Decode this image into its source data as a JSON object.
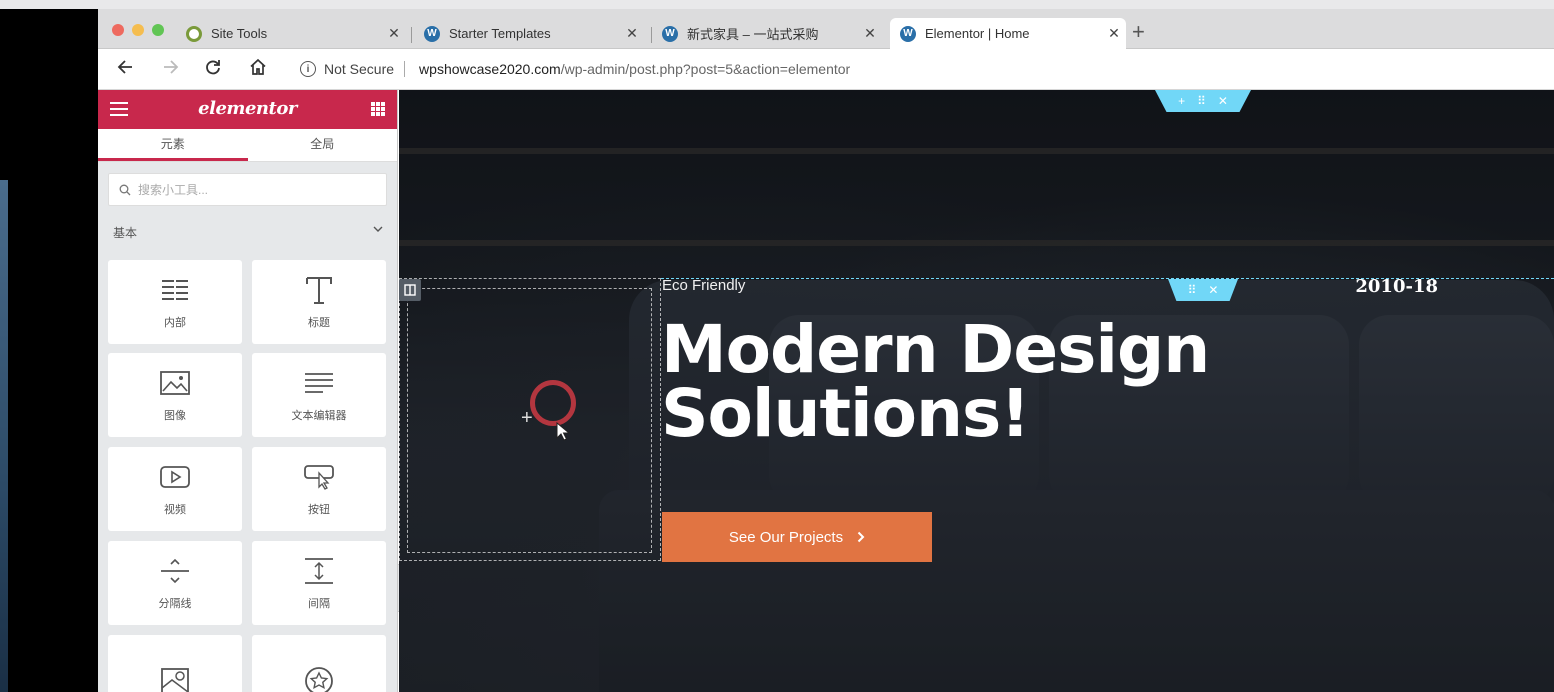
{
  "browser": {
    "tabs": [
      {
        "label": "Site Tools",
        "active": false
      },
      {
        "label": "Starter Templates",
        "active": false
      },
      {
        "label": "新式家具 – 一站式采购",
        "active": false
      },
      {
        "label": "Elementor | Home",
        "active": true
      }
    ],
    "close_glyph": "✕",
    "newtab_glyph": "+",
    "security_label": "Not Secure",
    "url_host": "wpshowcase2020.com",
    "url_path": "/wp-admin/post.php?post=5&action=elementor"
  },
  "panel": {
    "logo": "elementor",
    "tabs": [
      "元素",
      "全局"
    ],
    "search_placeholder": "搜索小工具...",
    "category": "基本",
    "widgets": [
      {
        "label": "内部",
        "icon": "inner-section-icon"
      },
      {
        "label": "标题",
        "icon": "heading-icon"
      },
      {
        "label": "图像",
        "icon": "image-icon"
      },
      {
        "label": "文本编辑器",
        "icon": "text-editor-icon"
      },
      {
        "label": "视频",
        "icon": "video-icon"
      },
      {
        "label": "按钮",
        "icon": "button-icon"
      },
      {
        "label": "分隔线",
        "icon": "divider-icon"
      },
      {
        "label": "间隔",
        "icon": "spacer-icon"
      },
      {
        "label": "",
        "icon": "google-maps-icon"
      },
      {
        "label": "",
        "icon": "icon-icon"
      }
    ]
  },
  "canvas": {
    "eyebrow": "Eco Friendly",
    "year": "2010-18",
    "headline_line1": "Modern Design",
    "headline_line2": "Solutions!",
    "cta_label": "See Our Projects",
    "accent_color": "#e17442",
    "handle_color": "#71d7f7"
  }
}
